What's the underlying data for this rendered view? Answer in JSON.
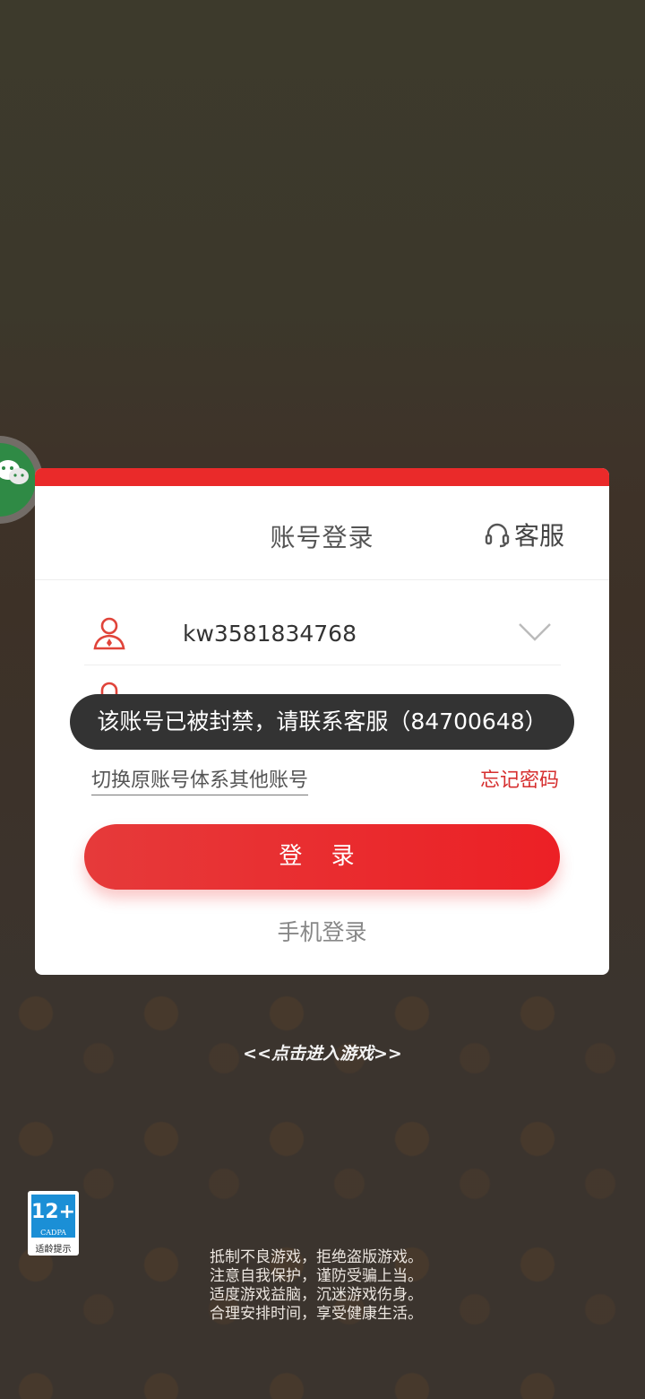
{
  "dialog": {
    "title": "账号登录",
    "service_label": "客服",
    "username_value": "kw3581834768",
    "password_mask": "●●●●●●●●●●",
    "switch_account_label": "切换原账号体系其他账号",
    "forgot_password_label": "忘记密码",
    "login_button_label": "登 录",
    "phone_login_label": "手机登录"
  },
  "toast": {
    "message": "该账号已被封禁，请联系客服（84700648）"
  },
  "enter_game_label": "<<点击进入游戏>>",
  "age_rating": {
    "age": "12+",
    "org": "CADPA",
    "caption": "适龄提示"
  },
  "health_notice": [
    "抵制不良游戏，拒绝盗版游戏。",
    "注意自我保护，谨防受骗上当。",
    "适度游戏益脑，沉迷游戏伤身。",
    "合理安排时间，享受健康生活。"
  ],
  "colors": {
    "accent": "#ea2a2a",
    "toast_bg": "#333333",
    "wechat": "#2f8a45"
  },
  "icons": {
    "user": "user-icon",
    "lock": "lock-icon",
    "chevron": "chevron-down-icon",
    "headset": "headset-icon",
    "wechat": "wechat-icon"
  }
}
